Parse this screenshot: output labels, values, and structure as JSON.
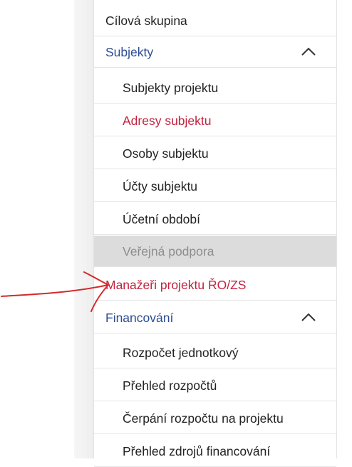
{
  "nav": {
    "items": [
      {
        "label": "Cílová skupina"
      },
      {
        "label": "Subjekty"
      },
      {
        "label": "Subjekty projektu"
      },
      {
        "label": "Adresy subjektu"
      },
      {
        "label": "Osoby subjektu"
      },
      {
        "label": "Účty subjektu"
      },
      {
        "label": "Účetní období"
      },
      {
        "label": "Veřejná podpora"
      },
      {
        "label": "Manažeři projektu ŘO/ZS"
      },
      {
        "label": "Financování"
      },
      {
        "label": "Rozpočet jednotkový"
      },
      {
        "label": "Přehled rozpočtů"
      },
      {
        "label": "Čerpání rozpočtu na projektu"
      },
      {
        "label": "Přehled zdrojů financování"
      }
    ]
  },
  "colors": {
    "section_text": "#2c4c93",
    "active_text": "#c2223e",
    "disabled_bg": "#dcdcdc",
    "annotation_arrow": "#d42a2a"
  },
  "icons": {
    "collapse": "chevron-up-icon",
    "annotation": "hand-drawn-arrow"
  }
}
